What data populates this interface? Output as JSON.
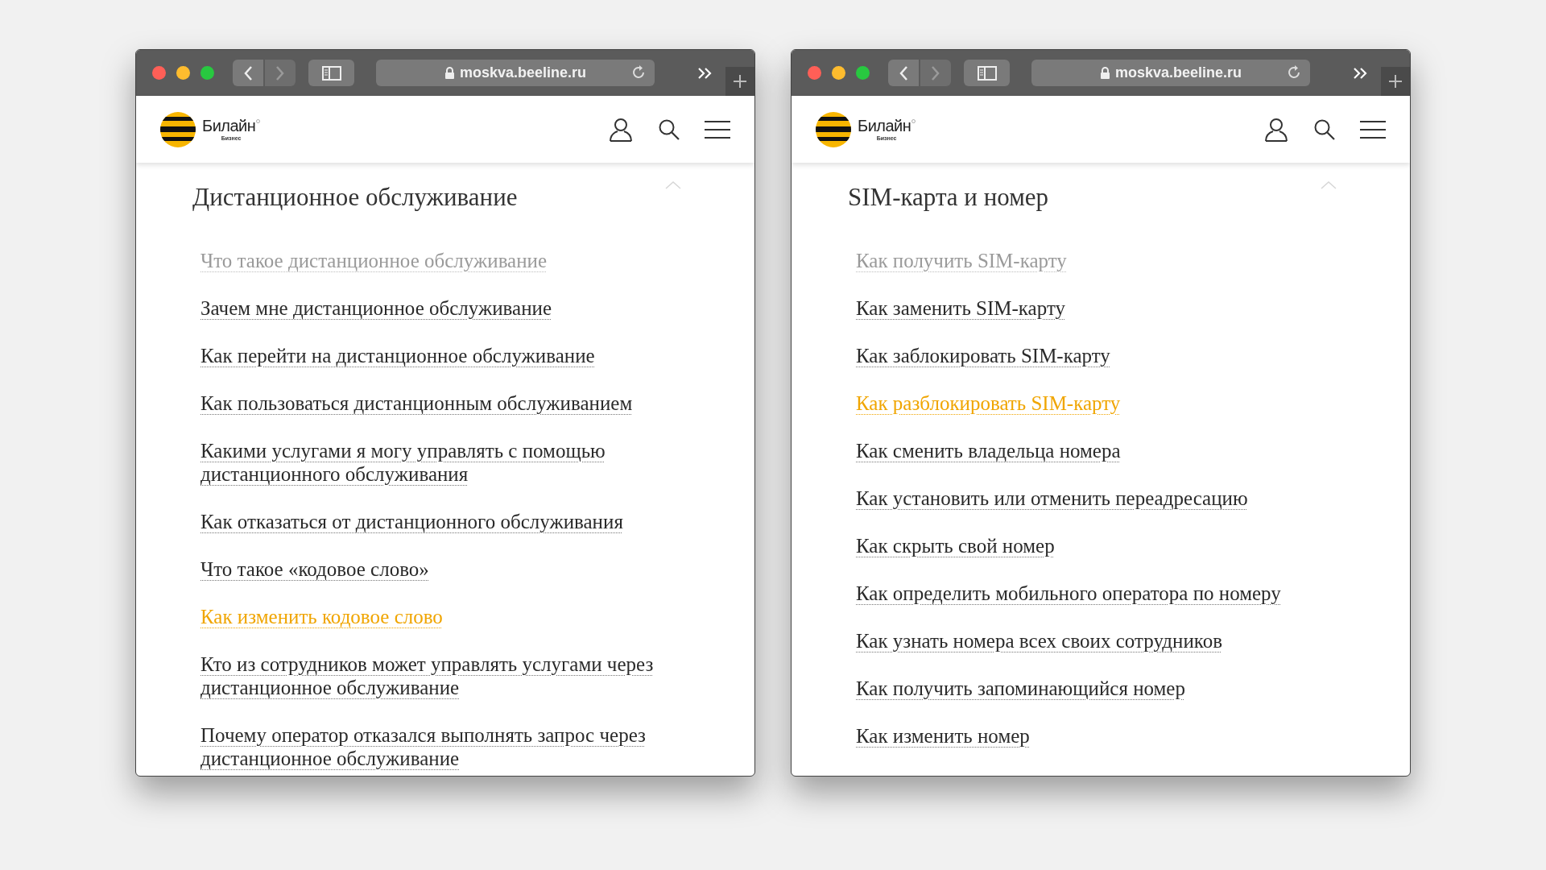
{
  "windows": [
    {
      "address": "moskva.beeline.ru",
      "logo": {
        "name": "Билайн",
        "subtitle": "Бизнес"
      },
      "section": {
        "title": "Дистанционное обслуживание",
        "expanded": true,
        "items": [
          {
            "label": "Что такое дистанционное обслуживание",
            "visited": true,
            "selected": false
          },
          {
            "label": "Зачем мне дистанционное обслуживание",
            "visited": false,
            "selected": false
          },
          {
            "label": "Как перейти на дистанционное обслуживание",
            "visited": false,
            "selected": false
          },
          {
            "label": "Как пользоваться дистанционным обслуживанием",
            "visited": false,
            "selected": false
          },
          {
            "label": "Какими услугами я могу управлять с помощью дистанционного обслуживания",
            "visited": false,
            "selected": false
          },
          {
            "label": "Как отказаться от дистанционного обслуживания",
            "visited": false,
            "selected": false
          },
          {
            "label": "Что такое «кодовое слово»",
            "visited": false,
            "selected": false
          },
          {
            "label": "Как изменить кодовое слово",
            "visited": false,
            "selected": true
          },
          {
            "label": "Кто из сотрудников может управлять услугами через дистанционное обслуживание",
            "visited": false,
            "selected": false
          },
          {
            "label": "Почему оператор отказался выполнять запрос через дистанционное обслуживание",
            "visited": false,
            "selected": false
          }
        ]
      }
    },
    {
      "address": "moskva.beeline.ru",
      "logo": {
        "name": "Билайн",
        "subtitle": "Бизнес"
      },
      "section": {
        "title": "SIM-карта и номер",
        "expanded": true,
        "items": [
          {
            "label": "Как получить SIM-карту",
            "visited": true,
            "selected": false
          },
          {
            "label": "Как заменить SIM-карту",
            "visited": false,
            "selected": false
          },
          {
            "label": "Как заблокировать SIM-карту",
            "visited": false,
            "selected": false
          },
          {
            "label": "Как разблокировать SIM-карту",
            "visited": false,
            "selected": true
          },
          {
            "label": "Как сменить владельца номера",
            "visited": false,
            "selected": false
          },
          {
            "label": "Как установить или отменить переадресацию",
            "visited": false,
            "selected": false
          },
          {
            "label": "Как скрыть свой номер",
            "visited": false,
            "selected": false
          },
          {
            "label": "Как определить мобильного оператора по номеру",
            "visited": false,
            "selected": false
          },
          {
            "label": "Как узнать номера всех своих сотрудников",
            "visited": false,
            "selected": false
          },
          {
            "label": "Как получить запоминающийся номер",
            "visited": false,
            "selected": false
          },
          {
            "label": "Как изменить номер",
            "visited": false,
            "selected": false
          }
        ]
      }
    }
  ]
}
